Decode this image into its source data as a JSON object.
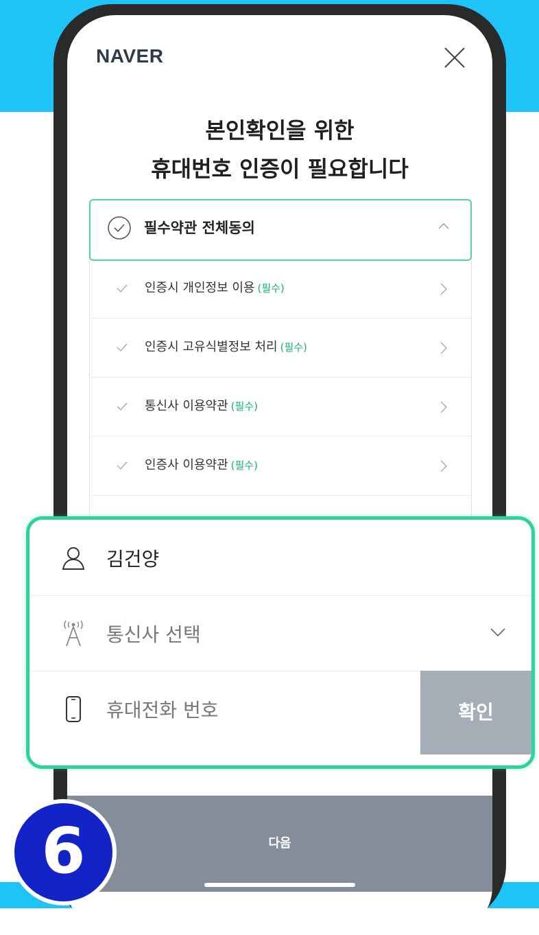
{
  "header": {
    "brand": "NAVER"
  },
  "headline": {
    "line1": "본인확인을 위한",
    "line2": "휴대번호 인증이 필요합니다"
  },
  "terms": {
    "all_agree_label": "필수약관 전체동의",
    "items": [
      {
        "label": "인증시 개인정보 이용",
        "tag": "(필수)"
      },
      {
        "label": "인증시 고유식별정보 처리",
        "tag": "(필수)"
      },
      {
        "label": "통신사 이용약관",
        "tag": "(필수)"
      },
      {
        "label": "인증사 이용약관",
        "tag": "(필수)"
      }
    ]
  },
  "form": {
    "name_value": "김건양",
    "carrier_placeholder": "통신사 선택",
    "phone_placeholder": "휴대전화 번호",
    "confirm_label": "확인"
  },
  "footer": {
    "next_label": "다음"
  },
  "step_number": "6",
  "colors": {
    "accent_green": "#2ed39a",
    "required_green": "#13b46b",
    "sky_blue": "#1ec4f5",
    "badge_blue": "#1224c8"
  }
}
